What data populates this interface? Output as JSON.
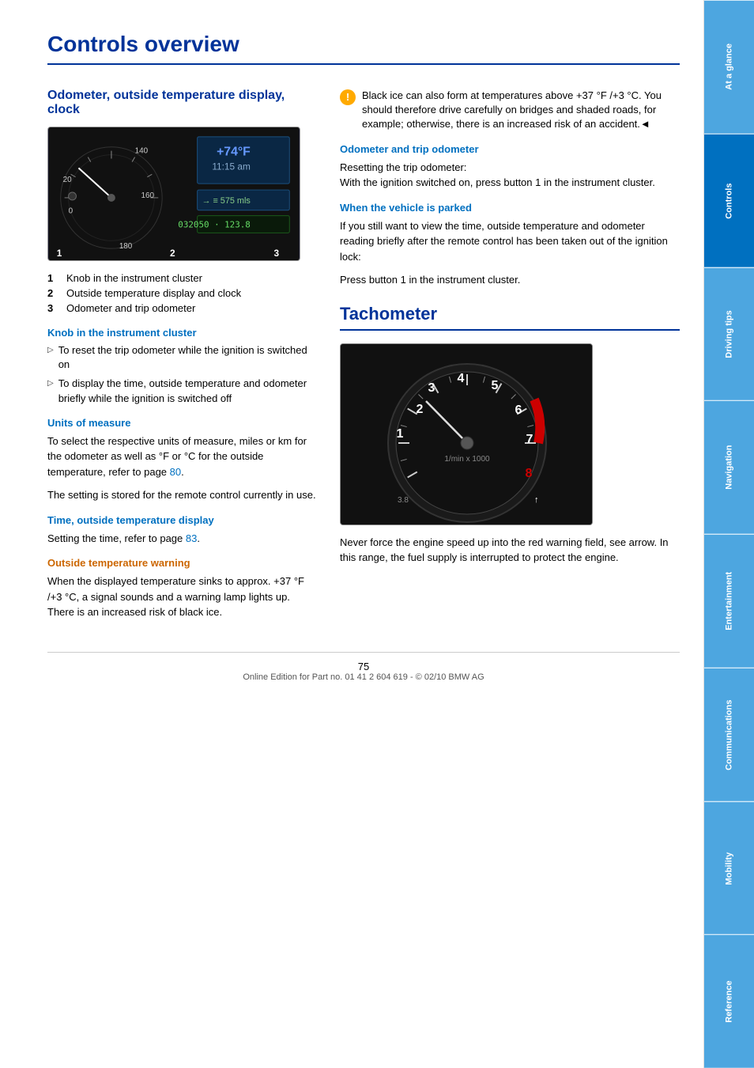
{
  "page": {
    "title": "Controls overview",
    "page_number": "75",
    "footer_text": "Online Edition for Part no. 01 41 2 604 619 - © 02/10 BMW AG"
  },
  "section1": {
    "header": "Odometer, outside temperature display, clock",
    "instrument_display": {
      "temp": "+74°F",
      "time": "11:15 am",
      "odometer": "032050 + 123.8",
      "arrow_label": "→ 575 mls"
    },
    "numbered_items": [
      {
        "num": "1",
        "text": "Knob in the instrument cluster"
      },
      {
        "num": "2",
        "text": "Outside temperature display and clock"
      },
      {
        "num": "3",
        "text": "Odometer and trip odometer"
      }
    ],
    "knob_header": "Knob in the instrument cluster",
    "knob_bullets": [
      "To reset the trip odometer while the ignition is switched on",
      "To display the time, outside temperature and odometer briefly while the ignition is switched off"
    ],
    "units_header": "Units of measure",
    "units_text": "To select the respective units of measure, miles or km for the odometer as well as  °F  or  °C for the outside temperature, refer to page 80.",
    "units_text2": "The setting is stored for the remote control currently in use.",
    "units_page_ref": "80",
    "time_header": "Time, outside temperature display",
    "time_text": "Setting the time, refer to page 83.",
    "time_page_ref": "83",
    "temp_warning_header": "Outside temperature warning",
    "temp_warning_text": "When the displayed temperature sinks to approx. +37 °F /+3 °C, a signal sounds and a warning lamp lights up. There is an increased risk of black ice."
  },
  "section1_right": {
    "warning_text": "Black ice can also form at temperatures above +37 °F /+3 °C. You should therefore drive carefully on bridges and shaded roads, for example; otherwise, there is an increased risk of an accident.◄",
    "odometer_trip_header": "Odometer and trip odometer",
    "odometer_trip_text": "Resetting the trip odometer:\nWith the ignition switched on, press button 1 in the instrument cluster.",
    "parked_header": "When the vehicle is parked",
    "parked_text": "If you still want to view the time, outside temperature and odometer reading briefly after the remote control has been taken out of the ignition lock:",
    "parked_text2": "Press button 1 in the instrument cluster."
  },
  "section2": {
    "header": "Tachometer",
    "body_text": "Never force the engine speed up into the red warning field, see arrow. In this range, the fuel supply is interrupted to protect the engine."
  },
  "sidebar": {
    "tabs": [
      {
        "label": "At a glance",
        "active": false
      },
      {
        "label": "Controls",
        "active": true
      },
      {
        "label": "Driving tips",
        "active": false
      },
      {
        "label": "Navigation",
        "active": false
      },
      {
        "label": "Entertainment",
        "active": false
      },
      {
        "label": "Communications",
        "active": false
      },
      {
        "label": "Mobility",
        "active": false
      },
      {
        "label": "Reference",
        "active": false
      }
    ]
  }
}
